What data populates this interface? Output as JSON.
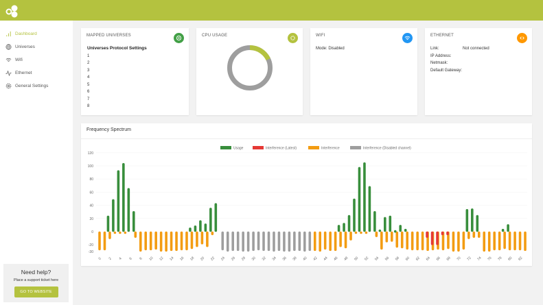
{
  "colors": {
    "brand": "#b4c23f",
    "usage": "#388e3c",
    "latest": "#e53935",
    "interference": "#f39c12",
    "disabled": "#9e9e9e",
    "wifi": "#2196f3",
    "ethernet": "#ff9800",
    "universes": "#43a047"
  },
  "sidebar": {
    "items": [
      {
        "label": "Dashboard",
        "icon": "bar-chart-icon",
        "active": true
      },
      {
        "label": "Universes",
        "icon": "globe-icon"
      },
      {
        "label": "Wifi",
        "icon": "wifi-icon"
      },
      {
        "label": "Ethernet",
        "icon": "pulse-icon"
      },
      {
        "label": "General Settings",
        "icon": "gear-icon"
      }
    ],
    "help": {
      "title": "Need help?",
      "text": "Place a support ticket here",
      "button": "GO TO WEBSITE"
    }
  },
  "cards": {
    "universes": {
      "title": "MAPPED UNIVERSES",
      "heading": "Universes Protocol Settings",
      "rows": [
        "1",
        "2",
        "3",
        "4",
        "5",
        "6",
        "7",
        "8"
      ]
    },
    "cpu": {
      "title": "CPU USAGE",
      "usage_percent": 18
    },
    "wifi": {
      "title": "WIFI",
      "mode": "Mode: Disabled"
    },
    "ethernet": {
      "title": "ETHERNET",
      "rows": [
        {
          "k": "Link:",
          "v": "Not connected"
        },
        {
          "k": "IP Address:",
          "v": ""
        },
        {
          "k": "Netmask:",
          "v": ""
        },
        {
          "k": "Default Gateway:",
          "v": ""
        }
      ]
    }
  },
  "spectrum": {
    "title": "Frequency Spectrum"
  },
  "chart_data": {
    "type": "bar",
    "legend": [
      "Usage",
      "Interference (Latest)",
      "Interference",
      "Interference (Disabled channel)"
    ],
    "legend_position": "top",
    "ylim": [
      -30,
      120
    ],
    "yticks": [
      120,
      100,
      80,
      60,
      40,
      20,
      0,
      -20,
      -30
    ],
    "xticks": [
      0,
      2,
      4,
      6,
      8,
      10,
      12,
      14,
      16,
      18,
      20,
      22,
      24,
      26,
      28,
      30,
      32,
      34,
      36,
      38,
      40,
      42,
      44,
      46,
      48,
      50,
      52,
      54,
      56,
      58,
      60,
      62,
      64,
      66,
      68,
      70,
      72,
      74,
      76,
      78,
      80,
      82
    ],
    "disabled_channels": [
      24,
      41
    ],
    "usage": [
      0,
      0,
      24,
      49,
      93,
      104,
      66,
      31,
      0,
      0,
      0,
      0,
      0,
      0,
      0,
      0,
      0,
      0,
      6,
      9,
      17,
      12,
      36,
      43,
      0,
      0,
      0,
      0,
      0,
      0,
      0,
      0,
      0,
      0,
      0,
      0,
      0,
      0,
      0,
      0,
      0,
      0,
      0,
      0,
      0,
      0,
      0,
      10,
      13,
      25,
      50,
      98,
      105,
      69,
      31,
      3,
      22,
      24,
      2,
      10,
      4,
      0,
      0,
      0,
      0,
      0,
      0,
      0,
      0,
      0,
      0,
      0,
      34,
      35,
      25,
      0,
      0,
      0,
      0,
      4,
      11,
      0,
      0,
      0
    ],
    "interference": [
      -28,
      -28,
      -11,
      -2,
      -1,
      -1,
      0,
      -9,
      -30,
      -28,
      -28,
      -27,
      -30,
      -30,
      -29,
      -29,
      -28,
      -28,
      -26,
      -23,
      -19,
      -23,
      -5,
      0,
      -28,
      -30,
      -29,
      -29,
      -30,
      -30,
      -29,
      -28,
      -29,
      -29,
      -30,
      -29,
      -30,
      -30,
      -29,
      -29,
      -30,
      -29,
      -29,
      -30,
      -27,
      -29,
      -29,
      -23,
      -25,
      -13,
      -1,
      -1,
      -1,
      0,
      -8,
      -27,
      -16,
      -15,
      -24,
      -25,
      -27,
      -28,
      -28,
      -28,
      -29,
      -28,
      -27,
      -28,
      -26,
      -30,
      -30,
      -27,
      -11,
      -9,
      -9,
      -30,
      -30,
      -28,
      -28,
      -26,
      -28,
      -28,
      -28,
      -29
    ],
    "interference_latest": {
      "64": -9,
      "65": -20,
      "66": -20,
      "67": -5,
      "68": -5
    }
  }
}
